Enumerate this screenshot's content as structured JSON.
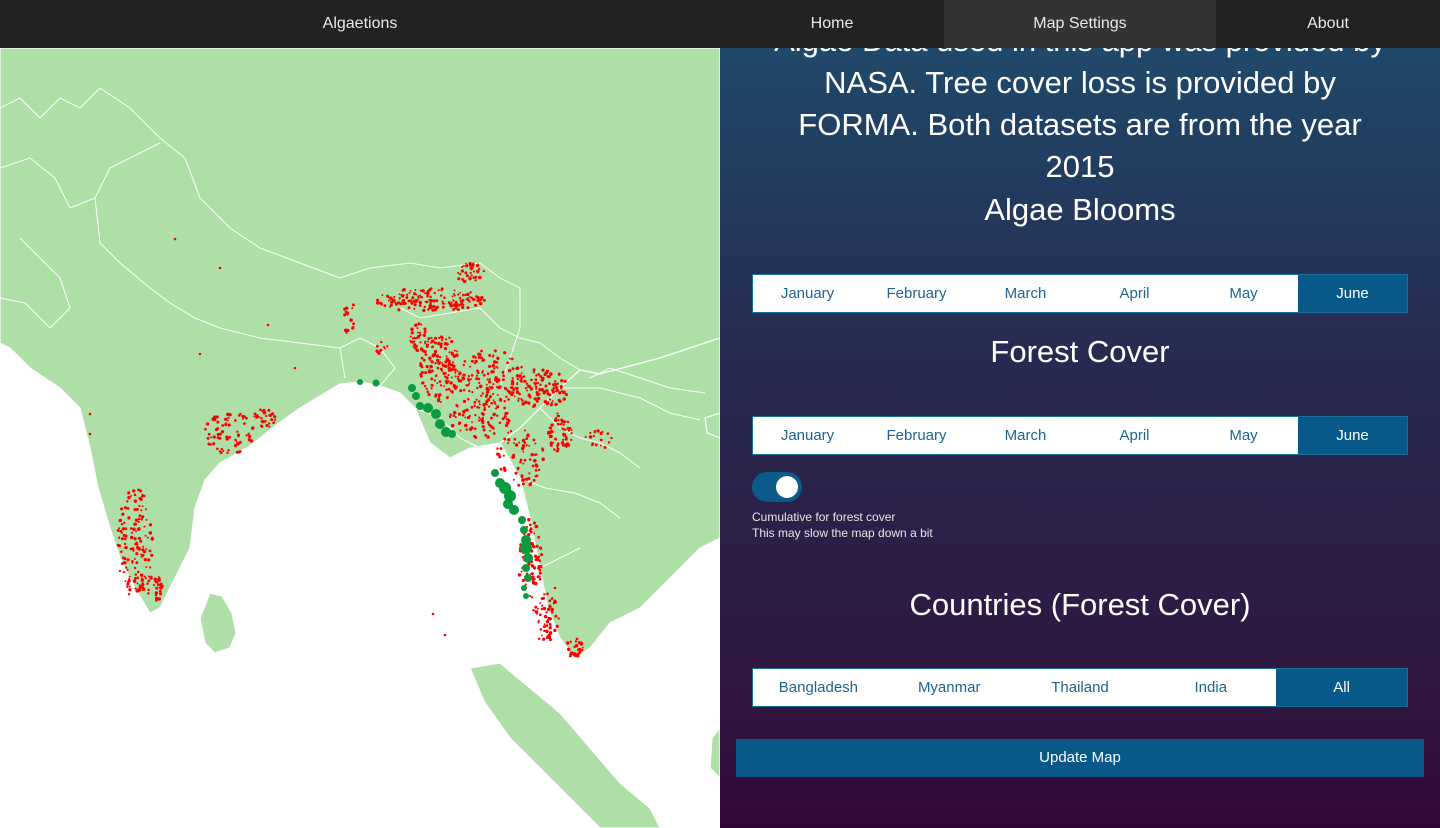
{
  "nav": {
    "brand": "Algaetions",
    "items": [
      {
        "label": "Home"
      },
      {
        "label": "Map Settings",
        "active": true
      },
      {
        "label": "About"
      }
    ]
  },
  "panel": {
    "intro": "Algae Data used in this app was provided by NASA. Tree cover loss is provided by FORMA. Both datasets are from the year 2015",
    "algae": {
      "title": "Algae Blooms",
      "months": [
        "January",
        "February",
        "March",
        "April",
        "May",
        "June"
      ],
      "selected": "June"
    },
    "forest": {
      "title": "Forest Cover",
      "months": [
        "January",
        "February",
        "March",
        "April",
        "May",
        "June"
      ],
      "selected": "June"
    },
    "cumulative": {
      "enabled": true,
      "label": "Cumulative for forest cover",
      "note": "This may slow the map down a bit"
    },
    "countries": {
      "title": "Countries (Forest Cover)",
      "options": [
        "Bangladesh",
        "Myanmar",
        "Thailand",
        "India",
        "All"
      ],
      "selected": "All"
    },
    "update_label": "Update Map"
  },
  "map": {
    "land_color": "#addfa7",
    "border_color": "#ffffff",
    "forest_loss_color": "#ff0000",
    "algae_bloom_color": "#0a9a40"
  }
}
